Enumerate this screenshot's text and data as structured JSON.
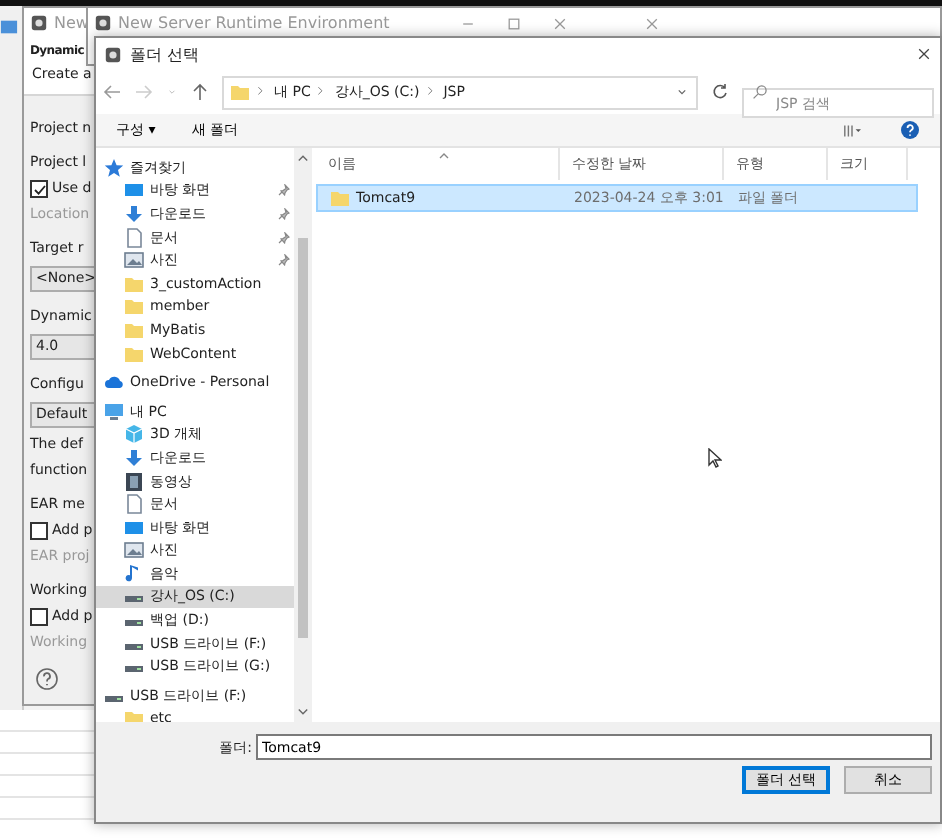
{
  "back_window": {
    "title": "New",
    "heading": "Dynamic",
    "subtitle": "Create a",
    "form": [
      {
        "kind": "label",
        "text": "Project n"
      },
      {
        "kind": "group",
        "text": "Project l"
      },
      {
        "kind": "checkbox",
        "text": "Use d",
        "checked": true
      },
      {
        "kind": "hint",
        "text": "Location"
      },
      {
        "kind": "group",
        "text": "Target r"
      },
      {
        "kind": "combo",
        "text": "<None>"
      },
      {
        "kind": "group",
        "text": "Dynamic"
      },
      {
        "kind": "combo",
        "text": "4.0"
      },
      {
        "kind": "group",
        "text": "Configu"
      },
      {
        "kind": "combo",
        "text": "Default"
      },
      {
        "kind": "label",
        "text": "The def"
      },
      {
        "kind": "label",
        "text": "function"
      },
      {
        "kind": "group",
        "text": "EAR me"
      },
      {
        "kind": "checkbox",
        "text": "Add p",
        "checked": false
      },
      {
        "kind": "hint",
        "text": "EAR proj"
      },
      {
        "kind": "group",
        "text": "Working"
      },
      {
        "kind": "checkbox",
        "text": "Add p",
        "checked": false
      },
      {
        "kind": "hint",
        "text": "Working"
      }
    ]
  },
  "server_window": {
    "title": "New Server Runtime Environment"
  },
  "folder_dialog": {
    "title": "폴더 선택",
    "address": [
      "내 PC",
      "강사_OS (C:)",
      "JSP"
    ],
    "search": {
      "placeholder": "JSP 검색"
    },
    "toolbar": [
      "구성 ▾",
      "새 폴더"
    ],
    "nav_tree": [
      {
        "label": "즐겨찾기",
        "kind": "star",
        "selected": false,
        "children": [
          {
            "label": "바탕 화면",
            "kind": "desktop",
            "pinned": true,
            "selected": false
          },
          {
            "label": "다운로드",
            "kind": "download",
            "pinned": true,
            "selected": false
          },
          {
            "label": "문서",
            "kind": "document",
            "pinned": true,
            "selected": false
          },
          {
            "label": "사진",
            "kind": "pictures",
            "pinned": true,
            "selected": false
          },
          {
            "label": "3_customAction",
            "kind": "folder",
            "pinned": false,
            "selected": false
          },
          {
            "label": "member",
            "kind": "folder",
            "pinned": false,
            "selected": false
          },
          {
            "label": "MyBatis",
            "kind": "folder",
            "pinned": false,
            "selected": false
          },
          {
            "label": "WebContent",
            "kind": "folder",
            "pinned": false,
            "selected": false
          }
        ]
      },
      {
        "label": "OneDrive - Personal",
        "kind": "cloud",
        "selected": false
      },
      {
        "label": "내 PC",
        "kind": "pc",
        "selected": false,
        "children": [
          {
            "label": "3D 개체",
            "kind": "cube",
            "selected": false
          },
          {
            "label": "다운로드",
            "kind": "download",
            "selected": false
          },
          {
            "label": "동영상",
            "kind": "video",
            "selected": false
          },
          {
            "label": "문서",
            "kind": "document",
            "selected": false
          },
          {
            "label": "바탕 화면",
            "kind": "desktop",
            "selected": false
          },
          {
            "label": "사진",
            "kind": "pictures",
            "selected": false
          },
          {
            "label": "음악",
            "kind": "music",
            "selected": false
          },
          {
            "label": "강사_OS (C:)",
            "kind": "drive",
            "selected": true
          },
          {
            "label": "백업 (D:)",
            "kind": "drive",
            "selected": false
          },
          {
            "label": "USB 드라이브 (F:)",
            "kind": "drive",
            "selected": false
          },
          {
            "label": "USB 드라이브 (G:)",
            "kind": "drive",
            "selected": false
          }
        ]
      },
      {
        "label": "USB 드라이브 (F:)",
        "kind": "drive",
        "selected": false,
        "children": [
          {
            "label": "etc",
            "kind": "folder",
            "selected": false
          }
        ]
      }
    ],
    "columns": [
      {
        "label": "이름",
        "sorted": true
      },
      {
        "label": "수정한 날짜",
        "sorted": false
      },
      {
        "label": "유형",
        "sorted": false
      },
      {
        "label": "크기",
        "sorted": false
      }
    ],
    "rows": [
      {
        "name": "Tomcat9",
        "date": "2023-04-24 오후 3:01",
        "type": "파일 폴더",
        "selected": true
      }
    ],
    "folder_label": "폴더:",
    "folder_value": "Tomcat9",
    "buttons": [
      {
        "label": "폴더 선택",
        "default": true
      },
      {
        "label": "취소",
        "default": false
      }
    ]
  }
}
